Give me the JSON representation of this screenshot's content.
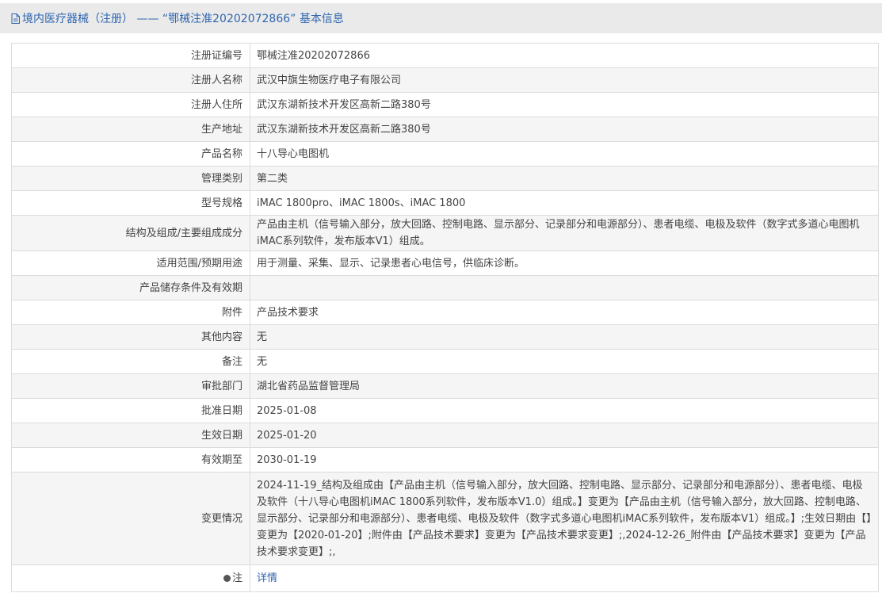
{
  "header": {
    "title": "境内医疗器械（注册） —— “鄂械注准20202072866” 基本信息"
  },
  "rows": [
    {
      "label": "注册证编号",
      "value": "鄂械注准20202072866"
    },
    {
      "label": "注册人名称",
      "value": "武汉中旗生物医疗电子有限公司"
    },
    {
      "label": "注册人住所",
      "value": "武汉东湖新技术开发区高新二路380号"
    },
    {
      "label": "生产地址",
      "value": "武汉东湖新技术开发区高新二路380号"
    },
    {
      "label": "产品名称",
      "value": "十八导心电图机"
    },
    {
      "label": "管理类别",
      "value": "第二类"
    },
    {
      "label": "型号规格",
      "value": "iMAC 1800pro、iMAC 1800s、iMAC 1800"
    },
    {
      "label": "结构及组成/主要组成成分",
      "value": "产品由主机（信号输入部分，放大回路、控制电路、显示部分、记录部分和电源部分）、患者电缆、电极及软件（数字式多道心电图机iMAC系列软件，发布版本V1）组成。"
    },
    {
      "label": "适用范围/预期用途",
      "value": "用于测量、采集、显示、记录患者心电信号，供临床诊断。"
    },
    {
      "label": "产品储存条件及有效期",
      "value": ""
    },
    {
      "label": "附件",
      "value": "产品技术要求"
    },
    {
      "label": "其他内容",
      "value": "无"
    },
    {
      "label": "备注",
      "value": "无"
    },
    {
      "label": "审批部门",
      "value": "湖北省药品监督管理局"
    },
    {
      "label": "批准日期",
      "value": "2025-01-08"
    },
    {
      "label": "生效日期",
      "value": "2025-01-20"
    },
    {
      "label": "有效期至",
      "value": "2030-01-19"
    },
    {
      "label": "变更情况",
      "value": "2024-11-19_结构及组成由【产品由主机（信号输入部分，放大回路、控制电路、显示部分、记录部分和电源部分）、患者电缆、电极及软件（十八导心电图机iMAC 1800系列软件，发布版本V1.0）组成。】变更为【产品由主机（信号输入部分，放大回路、控制电路、显示部分、记录部分和电源部分）、患者电缆、电极及软件（数字式多道心电图机iMAC系列软件，发布版本V1）组成。】;生效日期由【】变更为【2020-01-20】;附件由【产品技术要求】变更为【产品技术要求变更】;,2024-12-26_附件由【产品技术要求】变更为【产品技术要求变更】;,"
    }
  ],
  "note": {
    "label": "注",
    "link_text": "详情"
  },
  "colors": {
    "accent": "#2f66b0",
    "header_bg": "#eaeaea",
    "stripe_bg": "#f5f5f5",
    "border": "#dcdcdc"
  }
}
